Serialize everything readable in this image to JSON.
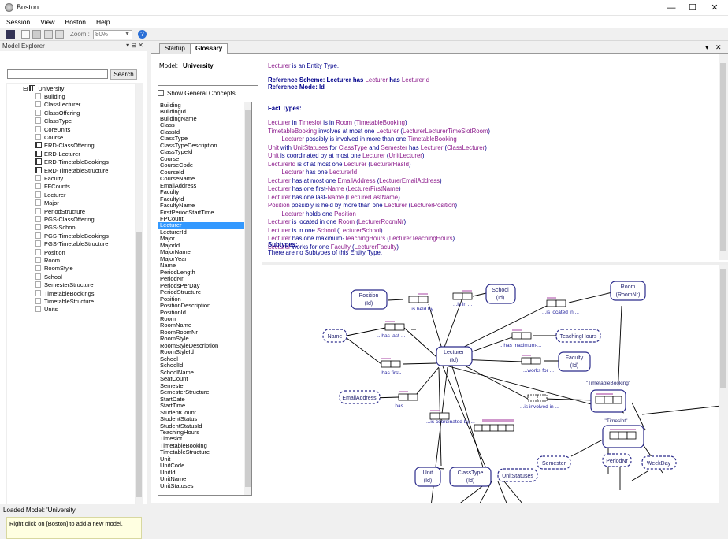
{
  "window": {
    "title": "Boston",
    "controls": [
      "minimize",
      "maximize",
      "close"
    ]
  },
  "menu": [
    "Session",
    "View",
    "Boston",
    "Help"
  ],
  "toolbar": {
    "zoom_label": "Zoom :",
    "zoom_value": "80%"
  },
  "explorer": {
    "title": "Model Explorer",
    "search_button": "Search",
    "root": "University",
    "items": [
      {
        "label": "Building",
        "kind": "doc"
      },
      {
        "label": "ClassLecturer",
        "kind": "doc"
      },
      {
        "label": "ClassOffering",
        "kind": "doc"
      },
      {
        "label": "ClassType",
        "kind": "doc"
      },
      {
        "label": "CoreUnits",
        "kind": "doc"
      },
      {
        "label": "Course",
        "kind": "doc"
      },
      {
        "label": "ERD-ClassOffering",
        "kind": "erd"
      },
      {
        "label": "ERD-Lecturer",
        "kind": "erd"
      },
      {
        "label": "ERD-TimetableBookings",
        "kind": "erd"
      },
      {
        "label": "ERD-TimetableStructure",
        "kind": "erd"
      },
      {
        "label": "Faculty",
        "kind": "doc"
      },
      {
        "label": "FFCounts",
        "kind": "doc"
      },
      {
        "label": "Lecturer",
        "kind": "doc"
      },
      {
        "label": "Major",
        "kind": "doc"
      },
      {
        "label": "PeriodStructure",
        "kind": "doc"
      },
      {
        "label": "PGS-ClassOffering",
        "kind": "doc"
      },
      {
        "label": "PGS-School",
        "kind": "doc"
      },
      {
        "label": "PGS-TimetableBookings",
        "kind": "doc"
      },
      {
        "label": "PGS-TimetableStructure",
        "kind": "doc"
      },
      {
        "label": "Position",
        "kind": "doc"
      },
      {
        "label": "Room",
        "kind": "doc"
      },
      {
        "label": "RoomStyle",
        "kind": "doc"
      },
      {
        "label": "School",
        "kind": "doc"
      },
      {
        "label": "SemesterStructure",
        "kind": "doc"
      },
      {
        "label": "TimetableBookings",
        "kind": "doc"
      },
      {
        "label": "TimetableStructure",
        "kind": "doc"
      },
      {
        "label": "Units",
        "kind": "doc"
      }
    ],
    "hint": "Right click on [Boston] to add a new model."
  },
  "tabs": [
    {
      "label": "Startup"
    },
    {
      "label": "Glossary",
      "active": true
    }
  ],
  "glossary": {
    "model_label": "Model:",
    "model_value": "University",
    "show_general": "Show General Concepts",
    "selected": "Lecturer",
    "concepts": [
      "Building",
      "BuildingId",
      "BuildingName",
      "Class",
      "ClassId",
      "ClassType",
      "ClassTypeDescription",
      "ClassTypeId",
      "Course",
      "CourseCode",
      "CourseId",
      "CourseName",
      "EmailAddress",
      "Faculty",
      "FacultyId",
      "FacultyName",
      "FirstPeriodStartTime",
      "FPCount",
      "Lecturer",
      "LecturerId",
      "Major",
      "MajorId",
      "MajorName",
      "MajorYear",
      "Name",
      "PeriodLength",
      "PeriodNr",
      "PeriodsPerDay",
      "PeriodStructure",
      "Position",
      "PositionDescription",
      "PositionId",
      "Room",
      "RoomName",
      "RoomRoomNr",
      "RoomStyle",
      "RoomStyleDescription",
      "RoomStyleId",
      "School",
      "SchoolId",
      "SchoolName",
      "SeatCount",
      "Semester",
      "SemesterStructure",
      "StartDate",
      "StartTime",
      "StudentCount",
      "StudentStatus",
      "StudentStatusId",
      "TeachingHours",
      "Timeslot",
      "TimetableBooking",
      "TimetableStructure",
      "Unit",
      "UnitCode",
      "UnitId",
      "UnitName",
      "UnitStatuses"
    ]
  },
  "description": {
    "line1_a": "Lecturer",
    "line1_b": " is an Entity Type.",
    "refscheme_a": "Reference Scheme: ",
    "refscheme_b": "Lecturer",
    "refscheme_c": " has ",
    "refscheme_d": "Lecturer",
    "refscheme_e": " has ",
    "refscheme_f": "LecturerId",
    "refmode": "Reference Mode: Id",
    "fact_types_heading": "Fact Types:",
    "facts": [
      [
        {
          "t": "Lecturer",
          "c": "purple"
        },
        {
          "t": " in ",
          "c": "navy"
        },
        {
          "t": "Timeslot",
          "c": "purple"
        },
        {
          "t": " is in ",
          "c": "navy"
        },
        {
          "t": "Room",
          "c": "purple"
        },
        {
          "t": " (",
          "c": "navy"
        },
        {
          "t": "TimetableBooking",
          "c": "purple"
        },
        {
          "t": ")",
          "c": "navy"
        }
      ],
      [
        {
          "t": "TimetableBooking",
          "c": "purple"
        },
        {
          "t": " involves at most one ",
          "c": "navy"
        },
        {
          "t": "Lecturer",
          "c": "purple"
        },
        {
          "t": " (",
          "c": "navy"
        },
        {
          "t": "LecturerLecturerTimeSlotRoom",
          "c": "purple"
        },
        {
          "t": ")",
          "c": "navy"
        }
      ],
      [
        {
          "t": "        Lecturer",
          "c": "purple"
        },
        {
          "t": " possibly is involved in more than one ",
          "c": "navy"
        },
        {
          "t": "TimetableBooking",
          "c": "purple"
        }
      ],
      [
        {
          "t": "Unit",
          "c": "purple"
        },
        {
          "t": " with ",
          "c": "navy"
        },
        {
          "t": "UnitStatuses",
          "c": "purple"
        },
        {
          "t": " for ",
          "c": "navy"
        },
        {
          "t": "ClassType",
          "c": "purple"
        },
        {
          "t": " and ",
          "c": "navy"
        },
        {
          "t": "Semester",
          "c": "purple"
        },
        {
          "t": " has ",
          "c": "navy"
        },
        {
          "t": "Lecturer",
          "c": "purple"
        },
        {
          "t": " (",
          "c": "navy"
        },
        {
          "t": "ClassLecturer",
          "c": "purple"
        },
        {
          "t": ")",
          "c": "navy"
        }
      ],
      [
        {
          "t": "Unit",
          "c": "purple"
        },
        {
          "t": " is coordinated by at most one ",
          "c": "navy"
        },
        {
          "t": "Lecturer",
          "c": "purple"
        },
        {
          "t": " (",
          "c": "navy"
        },
        {
          "t": "UnitLecturer",
          "c": "purple"
        },
        {
          "t": ")",
          "c": "navy"
        }
      ],
      [
        {
          "t": "LecturerId",
          "c": "purple"
        },
        {
          "t": " is of at most one ",
          "c": "navy"
        },
        {
          "t": "Lecturer",
          "c": "purple"
        },
        {
          "t": " (",
          "c": "navy"
        },
        {
          "t": "LecturerHasId",
          "c": "purple"
        },
        {
          "t": ")",
          "c": "navy"
        }
      ],
      [
        {
          "t": "        Lecturer",
          "c": "purple"
        },
        {
          "t": " has one ",
          "c": "navy"
        },
        {
          "t": "LecturerId",
          "c": "purple"
        }
      ],
      [
        {
          "t": "Lecturer",
          "c": "purple"
        },
        {
          "t": " has at most one ",
          "c": "navy"
        },
        {
          "t": "EmailAddress",
          "c": "purple"
        },
        {
          "t": " (",
          "c": "navy"
        },
        {
          "t": "LecturerEmailAddress",
          "c": "purple"
        },
        {
          "t": ")",
          "c": "navy"
        }
      ],
      [
        {
          "t": "Lecturer",
          "c": "purple"
        },
        {
          "t": " has one first-",
          "c": "navy"
        },
        {
          "t": "Name",
          "c": "purple"
        },
        {
          "t": " (",
          "c": "navy"
        },
        {
          "t": "LecturerFirstName",
          "c": "purple"
        },
        {
          "t": ")",
          "c": "navy"
        }
      ],
      [
        {
          "t": "Lecturer",
          "c": "purple"
        },
        {
          "t": " has one last-",
          "c": "navy"
        },
        {
          "t": "Name",
          "c": "purple"
        },
        {
          "t": " (",
          "c": "navy"
        },
        {
          "t": "LecturerLastName",
          "c": "purple"
        },
        {
          "t": ")",
          "c": "navy"
        }
      ],
      [
        {
          "t": "Position",
          "c": "purple"
        },
        {
          "t": " possibly is held by more than one ",
          "c": "navy"
        },
        {
          "t": "Lecturer",
          "c": "purple"
        },
        {
          "t": " (",
          "c": "navy"
        },
        {
          "t": "LecturerPosition",
          "c": "purple"
        },
        {
          "t": ")",
          "c": "navy"
        }
      ],
      [
        {
          "t": "        Lecturer",
          "c": "purple"
        },
        {
          "t": " holds one ",
          "c": "navy"
        },
        {
          "t": "Position",
          "c": "purple"
        }
      ],
      [
        {
          "t": "Lecturer",
          "c": "purple"
        },
        {
          "t": " is located in one ",
          "c": "navy"
        },
        {
          "t": "Room",
          "c": "purple"
        },
        {
          "t": " (",
          "c": "navy"
        },
        {
          "t": "LecturerRoomNr",
          "c": "purple"
        },
        {
          "t": ")",
          "c": "navy"
        }
      ],
      [
        {
          "t": "Lecturer",
          "c": "purple"
        },
        {
          "t": " is in one ",
          "c": "navy"
        },
        {
          "t": "School",
          "c": "purple"
        },
        {
          "t": " (",
          "c": "navy"
        },
        {
          "t": "LecturerSchool",
          "c": "purple"
        },
        {
          "t": ")",
          "c": "navy"
        }
      ],
      [
        {
          "t": "Lecturer",
          "c": "purple"
        },
        {
          "t": " has one maximum-",
          "c": "navy"
        },
        {
          "t": "TeachingHours",
          "c": "purple"
        },
        {
          "t": " (",
          "c": "navy"
        },
        {
          "t": "LecturerTeachingHours",
          "c": "purple"
        },
        {
          "t": ")",
          "c": "navy"
        }
      ],
      [
        {
          "t": "Lecturer",
          "c": "purple"
        },
        {
          "t": " works for one ",
          "c": "navy"
        },
        {
          "t": "Faculty",
          "c": "purple"
        },
        {
          "t": " (",
          "c": "navy"
        },
        {
          "t": "LecturerFaculty",
          "c": "purple"
        },
        {
          "t": ")",
          "c": "navy"
        }
      ]
    ],
    "subtypes_heading": "Subtypes:",
    "subtypes_text": "There are no Subtypes of this Entity Type."
  },
  "diagram": {
    "entities": {
      "position": [
        "Position",
        "(Id)"
      ],
      "school": [
        "School",
        "(Id)"
      ],
      "room": [
        "Room",
        "(RoomNr)"
      ],
      "lecturer": [
        "Lecturer",
        "(Id)"
      ],
      "faculty": [
        "Faculty",
        "(Id)"
      ],
      "unit": [
        "Unit",
        "(Id)"
      ],
      "classtype": [
        "ClassType",
        "(Id)"
      ]
    },
    "values": {
      "name": "Name",
      "teaching": "TeachingHours",
      "email": "EmailAddress",
      "semester": "Semester",
      "unitstatuses": "UnitStatuses",
      "periodnr": "PeriodNr",
      "weekday": "WeekDay"
    },
    "objectified": {
      "tb": "\"TimetableBooking\"",
      "ts": "\"Timeslot\""
    },
    "readings": {
      "heldby": "...is held by ...",
      "isin": "...is in ...",
      "located": "...is located in ...",
      "lastname": "...has last-...",
      "maximum": "...has maximum-...",
      "firstname": "...has first-...",
      "worksfor": "...works for ...",
      "has": "...has ...",
      "involved": "...is involved in ...",
      "coordinated": "...is coordinated by ..."
    }
  },
  "status": "Loaded Model: 'University'"
}
